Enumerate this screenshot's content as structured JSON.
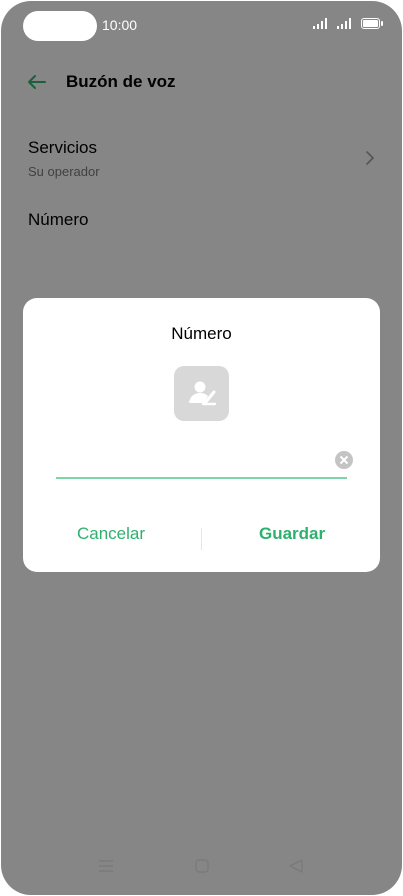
{
  "status": {
    "time": "10:00"
  },
  "header": {
    "title": "Buzón de voz"
  },
  "rows": {
    "servicios": {
      "label": "Servicios",
      "sub": "Su operador"
    },
    "numero": {
      "label": "Número"
    }
  },
  "dialog": {
    "title": "Número",
    "input_value": "",
    "cancel_label": "Cancelar",
    "save_label": "Guardar"
  },
  "icons": {
    "back": "arrow-left-icon",
    "chevron": "chevron-right-icon",
    "contact": "contact-picker-icon",
    "clear": "clear-icon",
    "nav": [
      "menu-icon",
      "home-icon",
      "back-icon"
    ]
  },
  "colors": {
    "accent": "#2fb06e",
    "underline": "#7ad6a8"
  }
}
